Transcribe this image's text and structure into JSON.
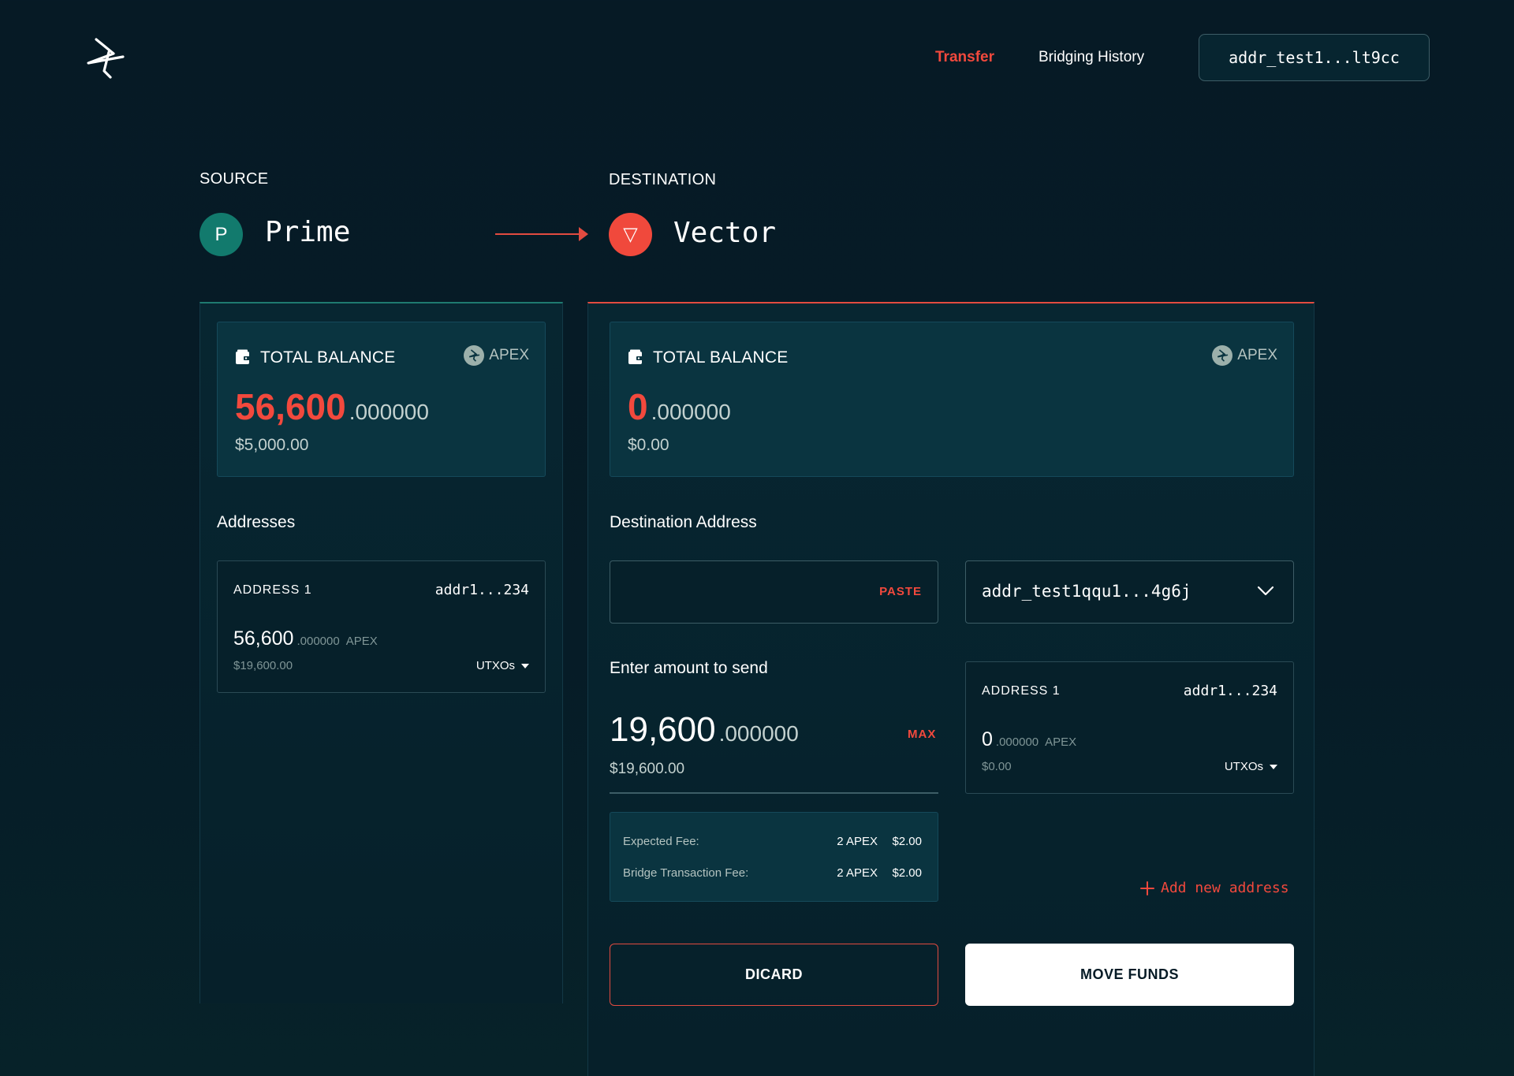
{
  "header": {
    "nav_transfer": "Transfer",
    "nav_history": "Bridging History",
    "wallet_address": "addr_test1...lt9cc"
  },
  "source": {
    "label": "SOURCE",
    "chain_initial": "P",
    "chain_name": "Prime",
    "chain_color": "#127a6d",
    "balance": {
      "title": "TOTAL BALANCE",
      "token": "APEX",
      "amount_int": "56,600",
      "amount_dec": ".000000",
      "usd": "$5,000.00"
    },
    "addresses_title": "Addresses",
    "addresses": [
      {
        "label": "ADDRESS 1",
        "address": "addr1...234",
        "amount_int": "56,600",
        "amount_dec": ".000000",
        "unit": "APEX",
        "usd": "$19,600.00",
        "utxos_label": "UTXOs"
      }
    ]
  },
  "destination": {
    "label": "DESTINATION",
    "chain_glyph": "▽",
    "chain_name": "Vector",
    "chain_color": "#f0493c",
    "balance": {
      "title": "TOTAL BALANCE",
      "token": "APEX",
      "amount_int": "0",
      "amount_dec": ".000000",
      "usd": "$0.00"
    },
    "address_title": "Destination Address",
    "address_input": {
      "value": "",
      "paste_label": "PASTE"
    },
    "address_select": {
      "selected": "addr_test1qqu1...4g6j"
    },
    "amount_title": "Enter amount to send",
    "amount_int": "19,600",
    "amount_dec": ".000000",
    "max_label": "MAX",
    "amount_usd": "$19,600.00",
    "fees": [
      {
        "label": "Expected Fee:",
        "amount": "2 APEX",
        "usd": "$2.00"
      },
      {
        "label": "Bridge Transaction Fee:",
        "amount": "2 APEX",
        "usd": "$2.00"
      }
    ],
    "selected_address_card": {
      "label": "ADDRESS 1",
      "address": "addr1...234",
      "amount_int": "0",
      "amount_dec": ".000000",
      "unit": "APEX",
      "usd": "$0.00",
      "utxos_label": "UTXOs"
    },
    "add_address_label": "Add new address",
    "discard_label": "DICARD",
    "move_label": "MOVE FUNDS"
  },
  "colors": {
    "accent": "#f2493d",
    "background": "#061b26",
    "prime": "#127a6d"
  }
}
